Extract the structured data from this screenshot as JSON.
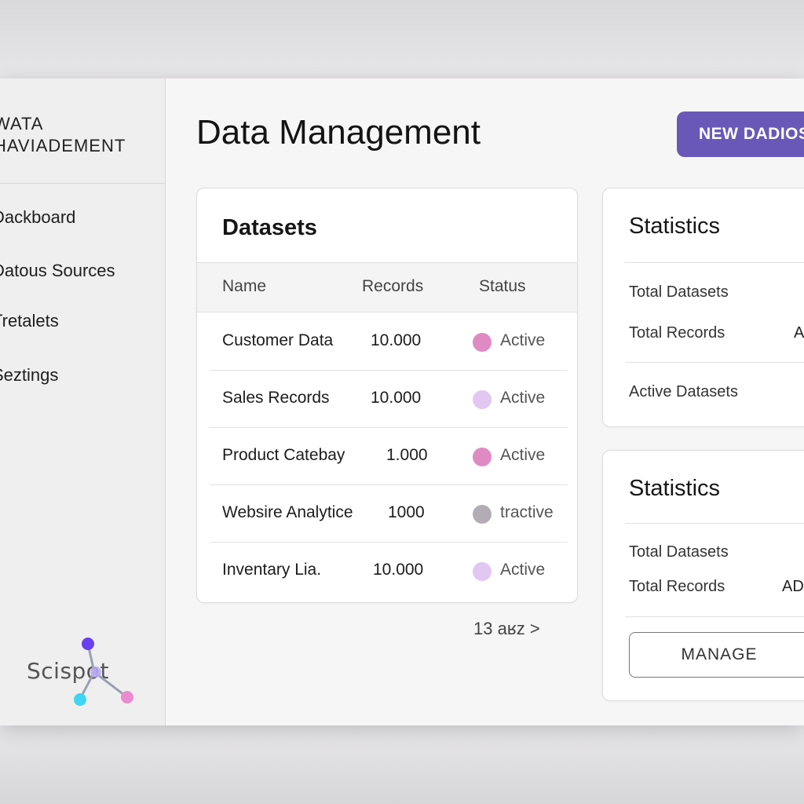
{
  "sidebar": {
    "app_title_line1": "WATA",
    "app_title_line2": "HAVIADEMENT",
    "items": [
      {
        "label": "Dackboard"
      },
      {
        "label": "Datous Sources"
      },
      {
        "label": "Tretalets"
      },
      {
        "label": "Seztings"
      }
    ],
    "brand": "Scispot"
  },
  "header": {
    "title": "Data Management",
    "new_button_label": "NEW DADIOS"
  },
  "datasets": {
    "title": "Datasets",
    "columns": [
      "Name",
      "Records",
      "Status"
    ],
    "rows": [
      {
        "name": "Customer Data",
        "records": "10.000",
        "status": "Active",
        "status_color": "#e08ac4"
      },
      {
        "name": "Sales Records",
        "records": "10.000",
        "status": "Active",
        "status_color": "#e2c7f2"
      },
      {
        "name": "Product Catebay",
        "records": "1.000",
        "status": "Active",
        "status_color": "#e08ac4"
      },
      {
        "name": "Websire Analytice",
        "records": "1000",
        "status": "tractive",
        "status_color": "#b2adb5"
      },
      {
        "name": "Inventary Lia.",
        "records": "10.000",
        "status": "Active",
        "status_color": "#e2c7f2"
      }
    ],
    "pager": "13 aʁz >"
  },
  "stats_primary": {
    "title": "Statistics",
    "total_datasets_label": "Total Datasets",
    "total_records_label": "Total Records",
    "total_records_value": "A",
    "active_datasets_label": "Active Datasets"
  },
  "stats_secondary": {
    "title": "Statistics",
    "total_datasets_label": "Total Datasets",
    "total_records_label": "Total Records",
    "total_records_value": "AD",
    "manage_label": "MANAGE"
  },
  "colors": {
    "accent": "#6a58b8",
    "active_pink": "#e08ac4",
    "active_lavender": "#e2c7f2",
    "inactive_grey": "#b2adb5"
  }
}
